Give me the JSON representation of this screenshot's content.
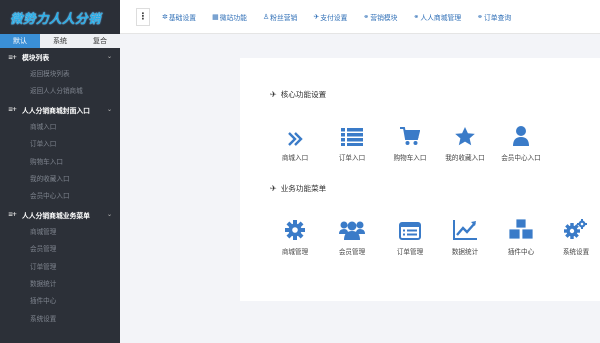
{
  "logo": "微势力人人分销",
  "sidebar": {
    "tabs": [
      "默认",
      "系统",
      "复合"
    ],
    "sections": [
      {
        "title": "模块列表",
        "items": [
          "返回模块列表",
          "返回人人分销商城"
        ]
      },
      {
        "title": "人人分销商城封面入口",
        "items": [
          "商城入口",
          "订单入口",
          "购物车入口",
          "我的收藏入口",
          "会员中心入口"
        ]
      },
      {
        "title": "人人分销商城业务菜单",
        "items": [
          "商城管理",
          "会员管理",
          "订单管理",
          "数据统计",
          "插件中心",
          "系统设置"
        ]
      }
    ]
  },
  "topbar": {
    "menu_icon": "⋮",
    "links": [
      "基础设置",
      "微站功能",
      "粉丝营销",
      "支付设置",
      "营销模块",
      "人人商城管理",
      "订单查询"
    ]
  },
  "main": {
    "core_title": "核心功能设置",
    "core_items": [
      "商城入口",
      "订单入口",
      "购物车入口",
      "我的收藏入口",
      "会员中心入口"
    ],
    "biz_title": "业务功能菜单",
    "biz_items": [
      "商城管理",
      "会员管理",
      "订单管理",
      "数据统计",
      "插件中心",
      "系统设置"
    ]
  },
  "colors": {
    "accent": "#3a7bc8",
    "sidebar_bg": "#2c3038",
    "active_tab": "#3a8fd6",
    "top_link": "#2f6fb7"
  },
  "icons": {
    "core": [
      "double-chevron-icon",
      "list-icon",
      "cart-icon",
      "star-icon",
      "user-icon"
    ],
    "biz": [
      "gear-icon",
      "users-icon",
      "form-icon",
      "chart-icon",
      "cubes-icon",
      "gears-icon"
    ]
  }
}
